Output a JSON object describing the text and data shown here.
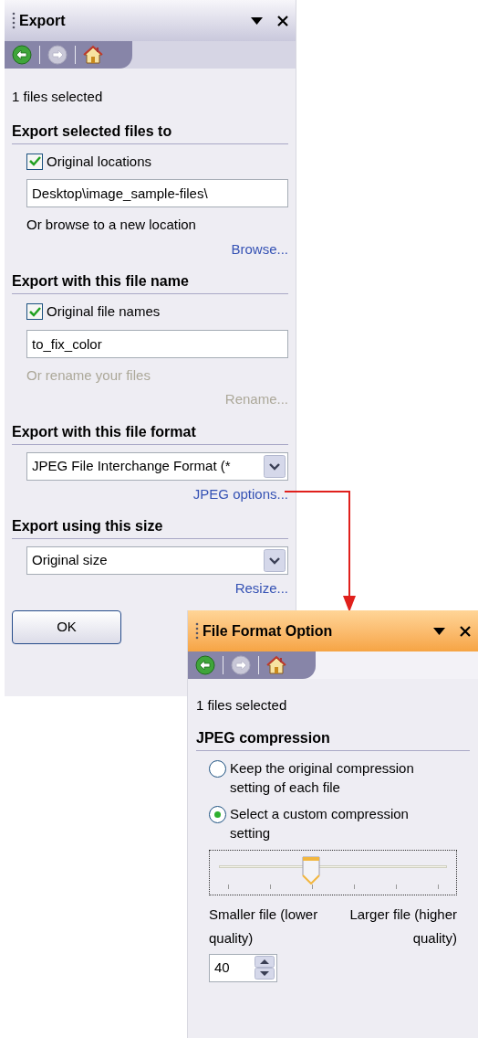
{
  "export_panel": {
    "title": "Export",
    "nav": [
      {
        "kind": "back",
        "disabled": false
      },
      {
        "kind": "forward",
        "disabled": true
      },
      {
        "kind": "home",
        "disabled": false
      }
    ],
    "files_selected": "1 files selected",
    "sections": [
      {
        "kind": "text_entry",
        "heading": "Export selected files to",
        "checkbox": {
          "label": "Original locations",
          "checked": true
        },
        "value": "Desktop\\image_sample-files\\",
        "hint": {
          "text": "Or browse to a new location",
          "disabled": false
        },
        "link": {
          "text": "Browse...",
          "disabled": false
        }
      },
      {
        "kind": "text_entry",
        "heading": "Export with this file name",
        "checkbox": {
          "label": "Original file names",
          "checked": true
        },
        "value": "to_fix_color",
        "hint": {
          "text": "Or rename your files",
          "disabled": true
        },
        "link": {
          "text": "Rename...",
          "disabled": true
        }
      },
      {
        "kind": "dropdown",
        "heading": "Export with this file format",
        "value": "JPEG File Interchange Format (*",
        "link": {
          "text": "JPEG options...",
          "disabled": false
        }
      },
      {
        "kind": "dropdown",
        "heading": "Export using this size",
        "value": "Original size",
        "link": {
          "text": "Resize...",
          "disabled": false
        }
      }
    ],
    "ok_button": "OK"
  },
  "options_panel": {
    "title": "File Format Option",
    "nav": [
      {
        "kind": "back",
        "disabled": false
      },
      {
        "kind": "forward",
        "disabled": true
      },
      {
        "kind": "home",
        "disabled": false
      }
    ],
    "files_selected": "1 files selected",
    "heading": "JPEG compression",
    "options": [
      {
        "label": "Keep the original compression setting of each file",
        "selected": false
      },
      {
        "label": "Select a custom compression setting",
        "selected": true
      }
    ],
    "slider": {
      "level": 0.41,
      "left_label": "Smaller file (lower quality)",
      "right_label": "Larger file (higher quality)"
    },
    "quality": "40"
  }
}
